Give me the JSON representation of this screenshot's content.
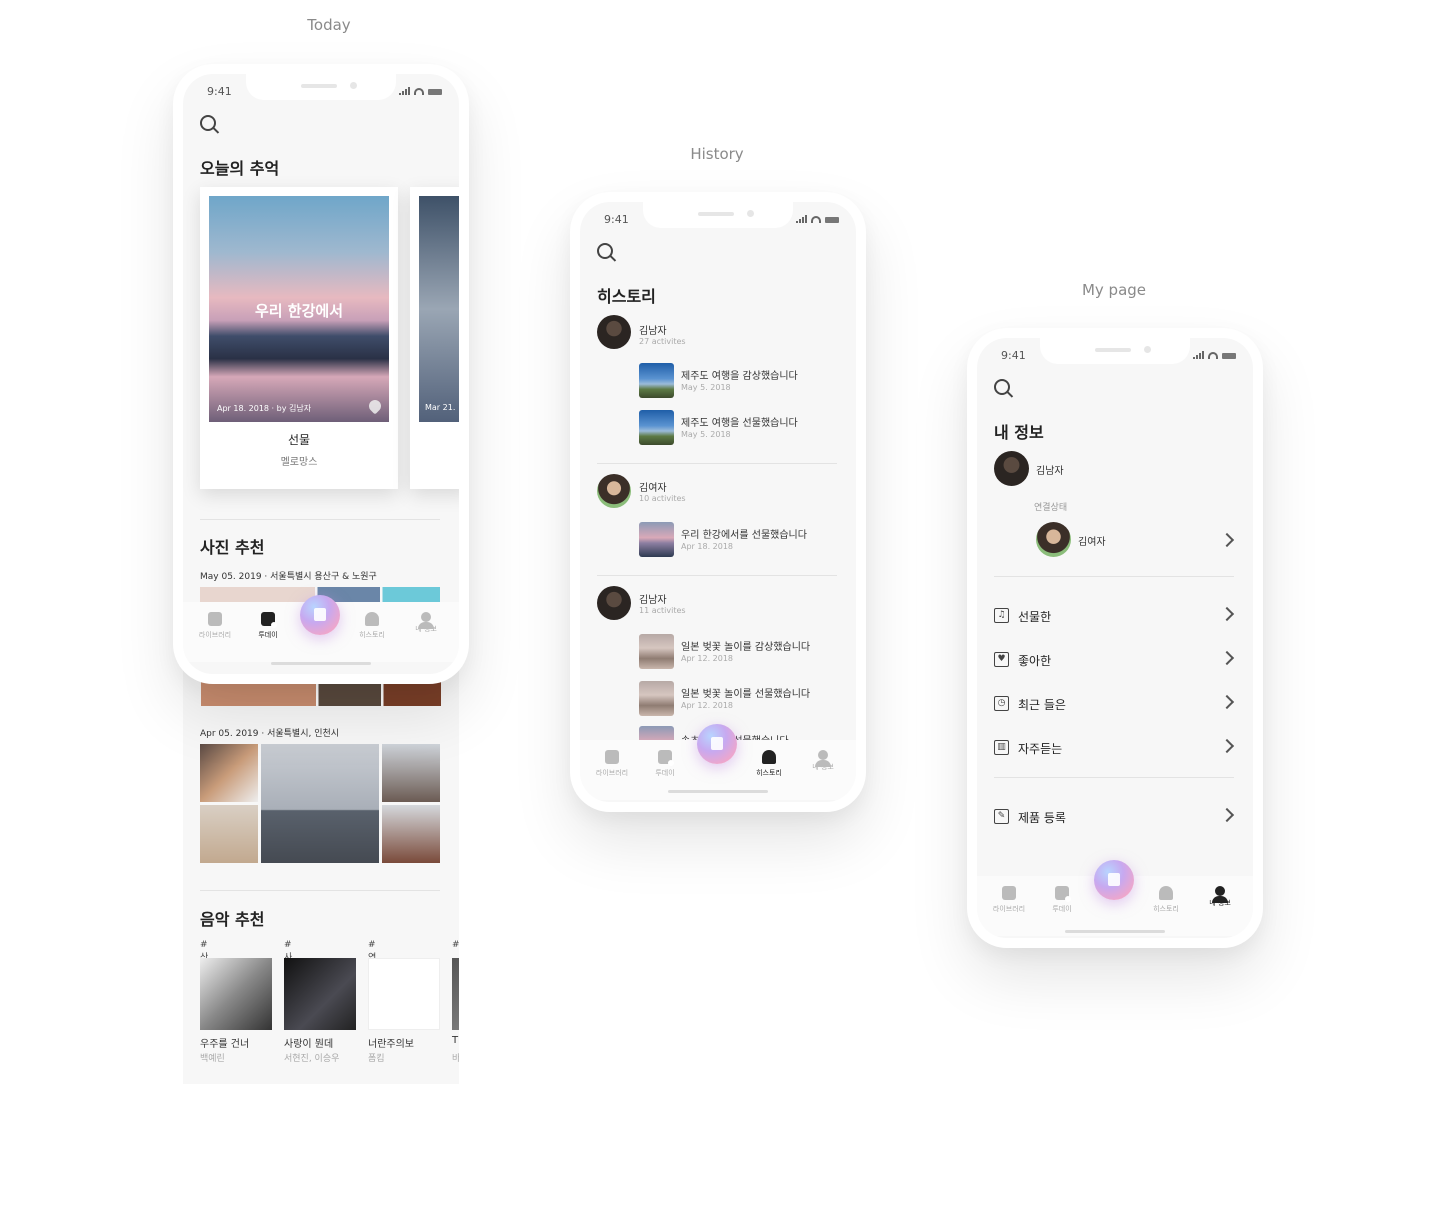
{
  "captions": {
    "today": "Today",
    "history": "History",
    "mypage": "My page"
  },
  "status": {
    "time": "9:41"
  },
  "nav": {
    "library": "라이브러리",
    "today": "투데이",
    "history": "히스토리",
    "myinfo": "내 정보"
  },
  "today": {
    "title": "오늘의 추억",
    "card": {
      "overlay": "우리 한강에서",
      "date": "Apr 18. 2018 · by 김남자",
      "song": "선물",
      "artist": "멜로망스",
      "next_date": "Mar 21."
    },
    "photo_title": "사진 추천",
    "photo_loc1": "May 05. 2019 · 서울특별시 용산구 & 노원구",
    "photo_loc2": "Apr 05. 2019 · 서울특별시, 인천시",
    "music_title": "음악 추천",
    "music": [
      {
        "tag": "# 산책",
        "title": "우주를 건너",
        "artist": "백예린"
      },
      {
        "tag": "# 사랑",
        "title": "사랑이 뭔데",
        "artist": "서현진, 이승우"
      },
      {
        "tag": "# 연인",
        "title": "너란주의보",
        "artist": "폼킴"
      },
      {
        "tag": "#",
        "title": "T",
        "artist": "바"
      }
    ]
  },
  "history": {
    "title": "히스토리",
    "groups": [
      {
        "name": "김남자",
        "count": "27 activites",
        "items": [
          {
            "text": "제주도 여행을 감상했습니다",
            "date": "May 5. 2018"
          },
          {
            "text": "제주도 여행을 선물했습니다",
            "date": "May 5. 2018"
          }
        ]
      },
      {
        "name": "김여자",
        "count": "10 activites",
        "items": [
          {
            "text": "우리 한강에서를 선물했습니다",
            "date": "Apr 18. 2018"
          }
        ]
      },
      {
        "name": "김남자",
        "count": "11 activites",
        "items": [
          {
            "text": "일본 벚꽃 놀이를 감상했습니다",
            "date": "Apr 12. 2018"
          },
          {
            "text": "일본 벚꽃 놀이를 선물했습니다",
            "date": "Apr 12. 2018"
          },
          {
            "text": "속초 여행을 선물했습니다",
            "date": ""
          }
        ]
      }
    ]
  },
  "mypage": {
    "title": "내 정보",
    "user": "김남자",
    "connected_label": "연결상태",
    "partner": "김여자",
    "menu": [
      "선물한",
      "좋아한",
      "최근 들은",
      "자주듣는"
    ],
    "register": "제품 등록"
  }
}
